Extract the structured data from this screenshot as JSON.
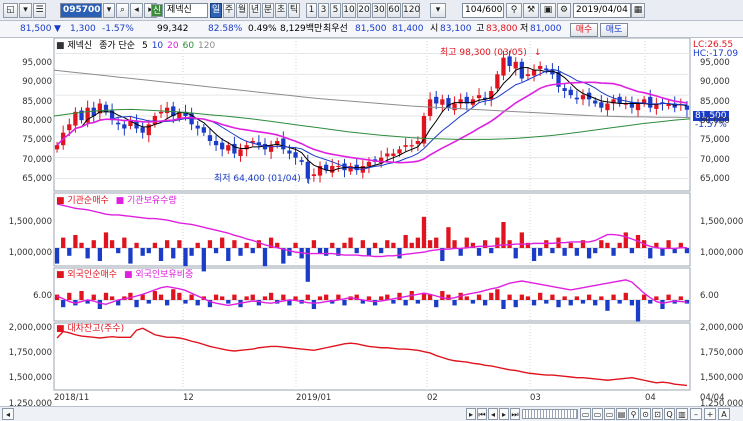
{
  "toolbar": {
    "code": "095700",
    "name": "제넥신",
    "period_buttons": [
      "일",
      "주",
      "월",
      "년",
      "분",
      "초",
      "틱"
    ],
    "interval_buttons": [
      "1",
      "3",
      "5",
      "10",
      "20",
      "30",
      "60",
      "120"
    ],
    "count": "104",
    "count_total": "/600",
    "date": "2019/04/04"
  },
  "quote": {
    "price": "81,500",
    "change": "1,300",
    "change_pct": "-1.57%",
    "volume": "99,342",
    "vol_ratio": "82.58%",
    "turnover_pct": "0.49%",
    "amount": "8,129백만",
    "best_ask_label": "최우선",
    "best_ask": "81,500",
    "best_bid": "81,400",
    "open_label": "시",
    "open": "83,100",
    "high_label": "고",
    "high": "83,800",
    "low_label": "저",
    "low": "81,000",
    "buy_label": "매수",
    "sell_label": "매도"
  },
  "panels": {
    "price": {
      "title": "제넥신",
      "ma_label": "종가 단순",
      "ma_periods": [
        "5",
        "10",
        "20",
        "60",
        "120"
      ],
      "high_note": "최고 98,300 (03/05)",
      "low_note": "최저 64,400 (01/04)",
      "lc": "LC:26.55",
      "hc": "HC:-17.09",
      "last_price": "81,500",
      "last_pct": "-1.57%",
      "yticks": [
        "95,000",
        "90,000",
        "85,000",
        "80,000",
        "75,000",
        "70,000",
        "65,000"
      ]
    },
    "inst": {
      "series1": "기관순매수",
      "series2": "기관보유수량",
      "yticks": [
        "1,500,000",
        "1,000,000"
      ]
    },
    "foreign": {
      "series1": "외국인순매수",
      "series2": "외국인보유비중",
      "yticks": [
        "6.00"
      ]
    },
    "loan": {
      "series1": "대차잔고(주수)",
      "yticks": [
        "2,000,000",
        "1,750,000",
        "1,500,000",
        "1,250,000"
      ]
    }
  },
  "xaxis": [
    "2018/11",
    "12",
    "2019/01",
    "02",
    "03",
    "04",
    "04/04"
  ],
  "chart_data": {
    "type": "line",
    "x_range": [
      "2018/11",
      "2019/04/04"
    ],
    "price_ylim": [
      62000,
      98000
    ],
    "annotations": {
      "high": 98300,
      "high_date": "03/05",
      "low": 64400,
      "low_date": "01/04"
    },
    "ma_colors": {
      "5": "#000000",
      "10": "#1a3cc8",
      "20": "#e020e0",
      "60": "#2e8b3c",
      "120": "#8c8c8c"
    },
    "up_color": "#e0141e",
    "down_color": "#1a3cc8",
    "close": [
      73,
      76,
      78,
      81,
      79,
      82,
      80,
      83,
      81,
      79,
      78,
      77,
      79,
      77,
      76,
      78,
      80,
      81,
      82,
      80,
      81,
      80,
      78,
      77,
      76,
      74,
      73,
      72,
      73,
      71,
      72,
      73,
      74,
      73,
      72,
      73,
      74,
      72,
      71,
      70,
      69,
      65,
      66,
      68,
      67,
      68,
      68,
      67,
      68,
      67,
      68,
      69,
      69,
      70,
      71,
      71,
      72,
      73,
      73,
      74,
      80,
      84,
      83,
      84,
      82,
      83,
      84,
      83,
      84,
      85,
      84,
      86,
      90,
      94,
      92,
      93,
      89,
      90,
      91,
      92,
      91,
      90,
      87,
      86,
      85,
      84,
      85,
      84,
      83,
      82,
      83,
      84,
      83,
      83,
      82,
      83,
      84,
      82,
      83,
      83,
      83,
      82,
      82.8,
      81.5
    ],
    "inst_net": [
      -0.6,
      0.4,
      -0.3,
      0.5,
      0.2,
      -0.4,
      0.3,
      -0.5,
      0.6,
      0.3,
      -0.2,
      0.4,
      -0.6,
      0.2,
      -0.3,
      -0.2,
      0.2,
      -0.5,
      0.3,
      -0.4,
      0.3,
      -0.7,
      -0.3,
      0.2,
      -0.9,
      0.3,
      -0.2,
      0.4,
      -0.5,
      0.3,
      -0.3,
      0.2,
      -0.2,
      0.3,
      -0.7,
      0.4,
      0.2,
      -0.6,
      -0.3,
      0.2,
      -0.4,
      -1.3,
      0.3,
      -0.2,
      -0.3,
      0.2,
      -0.3,
      0.2,
      0.4,
      -0.2,
      0.3,
      -0.3,
      0.2,
      -0.2,
      0.3,
      0.2,
      -0.4,
      0.5,
      0.2,
      0.4,
      1.2,
      0.3,
      0.4,
      -0.5,
      0.8,
      0.3,
      -0.3,
      0.4,
      0.2,
      -0.3,
      0.3,
      -0.2,
      0.4,
      1.0,
      0.3,
      -0.4,
      0.6,
      0.2,
      -0.5,
      -0.3,
      0.3,
      -0.2,
      0.4,
      -0.3,
      0.2,
      -0.3,
      0.3,
      -0.4,
      -0.2,
      0.3,
      0.2,
      -0.3,
      0.2,
      0.6,
      -0.2,
      0.5,
      0.3,
      -0.4,
      0.2,
      -0.3,
      0.3,
      -0.2,
      0.2,
      -0.2
    ],
    "inst_hold": [
      1.7,
      1.68,
      1.66,
      1.64,
      1.63,
      1.62,
      1.6,
      1.58,
      1.56,
      1.55,
      1.55,
      1.54,
      1.53,
      1.52,
      1.51,
      1.5,
      1.5,
      1.49,
      1.48,
      1.46,
      1.44,
      1.43,
      1.42,
      1.4,
      1.38,
      1.36,
      1.34,
      1.32,
      1.3,
      1.27,
      1.25,
      1.22,
      1.2,
      1.17,
      1.14,
      1.12,
      1.1,
      1.08,
      1.06,
      1.04,
      1.03,
      1.02,
      1.02,
      1.02,
      1.02,
      1.02,
      1.01,
      1.0,
      1.0,
      1.0,
      0.99,
      0.99,
      0.98,
      0.98,
      0.99,
      0.99,
      1.0,
      1.01,
      1.02,
      1.03,
      1.04,
      1.06,
      1.07,
      1.08,
      1.08,
      1.09,
      1.09,
      1.1,
      1.11,
      1.12,
      1.12,
      1.12,
      1.13,
      1.14,
      1.14,
      1.15,
      1.15,
      1.15,
      1.16,
      1.16,
      1.16,
      1.16,
      1.17,
      1.17,
      1.18,
      1.18,
      1.18,
      1.18,
      1.2,
      1.24,
      1.28,
      1.28,
      1.27,
      1.25,
      1.22,
      1.19,
      1.15,
      1.12,
      1.1,
      1.09,
      1.09,
      1.09,
      1.1,
      1.1
    ],
    "foreign_net": [
      0.3,
      -0.4,
      0.4,
      -0.3,
      0.5,
      -0.2,
      0.3,
      -0.5,
      0.4,
      0.2,
      -0.3,
      0.2,
      0.4,
      -0.4,
      0.3,
      -0.2,
      0.5,
      0.3,
      -0.3,
      0.6,
      0.4,
      -0.2,
      0.3,
      -0.3,
      0.2,
      -0.4,
      0.3,
      0.2,
      -0.2,
      0.3,
      -0.4,
      0.2,
      0.3,
      -0.3,
      0.2,
      0.4,
      -0.2,
      0.3,
      -0.3,
      0.2,
      -0.2,
      0.3,
      -0.5,
      0.2,
      0.3,
      -0.2,
      0.3,
      -0.3,
      0.2,
      0.3,
      -0.2,
      0.2,
      -0.3,
      0.2,
      0.3,
      -0.2,
      0.4,
      -0.3,
      0.5,
      -0.2,
      0.4,
      0.3,
      -0.4,
      0.5,
      0.3,
      -0.3,
      0.4,
      0.2,
      -0.2,
      0.3,
      -0.3,
      0.4,
      0.6,
      -0.5,
      0.3,
      -0.4,
      0.3,
      0.2,
      -0.3,
      0.4,
      -0.2,
      0.3,
      -0.4,
      0.2,
      -0.3,
      0.2,
      -0.2,
      0.3,
      -0.3,
      0.2,
      -0.6,
      0.3,
      -0.2,
      0.4,
      -0.3,
      -1.2,
      0.3,
      -0.2,
      0.2,
      -0.5,
      0.3,
      -0.2,
      0.2,
      -0.2
    ],
    "foreign_hold": [
      6.15,
      6.1,
      6.05,
      6.02,
      6.05,
      6.08,
      6.06,
      6.02,
      6.0,
      6.04,
      6.08,
      6.1,
      6.12,
      6.15,
      6.18,
      6.22,
      6.26,
      6.3,
      6.32,
      6.3,
      6.28,
      6.25,
      6.2,
      6.15,
      6.1,
      6.05,
      6.02,
      6.0,
      5.98,
      6.0,
      6.02,
      6.04,
      6.06,
      6.05,
      6.03,
      6.02,
      6.04,
      6.06,
      6.08,
      6.07,
      6.05,
      6.03,
      6.02,
      6.03,
      6.05,
      6.06,
      6.08,
      6.1,
      6.12,
      6.1,
      6.08,
      6.06,
      6.05,
      6.06,
      6.08,
      6.1,
      6.12,
      6.14,
      6.16,
      6.18,
      6.2,
      6.18,
      6.15,
      6.12,
      6.1,
      6.12,
      6.15,
      6.18,
      6.2,
      6.22,
      6.25,
      6.28,
      6.3,
      6.34,
      6.38,
      6.4,
      6.42,
      6.4,
      6.38,
      6.36,
      6.34,
      6.32,
      6.3,
      6.28,
      6.26,
      6.28,
      6.3,
      6.32,
      6.34,
      6.36,
      6.38,
      6.4,
      6.42,
      6.44,
      6.4,
      6.3,
      6.2,
      6.12,
      6.05,
      6.02,
      6.04,
      6.06,
      6.05,
      6.04
    ],
    "loan_balance": [
      1.85,
      1.95,
      1.93,
      1.9,
      1.88,
      1.87,
      1.86,
      1.85,
      1.86,
      1.87,
      1.86,
      1.86,
      1.86,
      1.97,
      2.0,
      1.95,
      1.9,
      1.88,
      1.86,
      1.86,
      1.85,
      1.83,
      1.8,
      1.78,
      1.75,
      1.72,
      1.7,
      1.68,
      1.66,
      1.65,
      1.66,
      1.67,
      1.68,
      1.7,
      1.71,
      1.72,
      1.72,
      1.71,
      1.7,
      1.69,
      1.68,
      1.67,
      1.66,
      1.68,
      1.7,
      1.72,
      1.74,
      1.76,
      1.77,
      1.76,
      1.74,
      1.72,
      1.71,
      1.7,
      1.7,
      1.69,
      1.68,
      1.68,
      1.67,
      1.66,
      1.64,
      1.62,
      1.58,
      1.55,
      1.52,
      1.5,
      1.49,
      1.48,
      1.46,
      1.45,
      1.43,
      1.42,
      1.4,
      1.38,
      1.36,
      1.35,
      1.33,
      1.31,
      1.3,
      1.29,
      1.28,
      1.28,
      1.27,
      1.26,
      1.25,
      1.24,
      1.24,
      1.23,
      1.22,
      1.21,
      1.2,
      1.21,
      1.22,
      1.23,
      1.24,
      1.22,
      1.2,
      1.18,
      1.16,
      1.17,
      1.16,
      1.14,
      1.13,
      1.12
    ]
  }
}
